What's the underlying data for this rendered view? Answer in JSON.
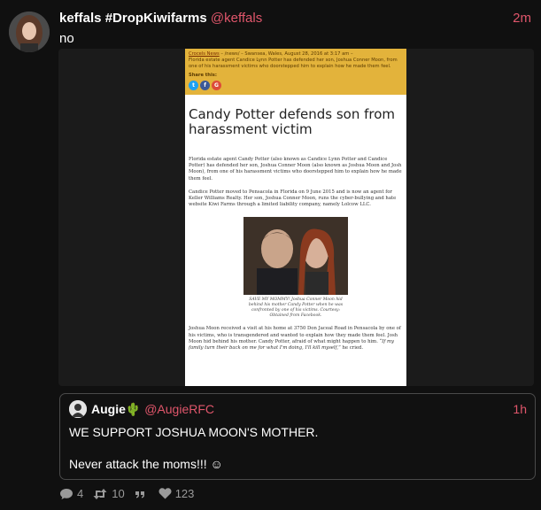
{
  "post": {
    "display_name": "keffals #DropKiwifarms",
    "handle": "@keffals",
    "time": "2m",
    "text": "no"
  },
  "article": {
    "header_line1_link": "Crocels News",
    "header_line1_rest": " – /news/ – Swansea, Wales, August 28, 2016 at 3:17 am –",
    "header_line2": "Florida estate agent Candice Lynn Potter has defended her son, Joshua Conner Moon, from one of his harassment victims who doorstepped him to explain how he made them feel.",
    "share_label": "Share this:",
    "share_icons": [
      "twitter-icon",
      "facebook-icon",
      "google-plus-icon"
    ],
    "title": "Candy Potter defends son from harassment victim",
    "para1": "Florida estate agent Candy Potter (also known as Candice Lynn Potter and Candice Potter) has defended her son, Joshua Conner Moon (also known as Joshua Moon and Josh Moon), from one of his harassment victims who doorstepped him to explain how he made them feel.",
    "para2": "Candice Potter moved to Pensacola in Florida on 9 June 2015 and is now an agent for Keller Williams Realty. Her son, Joshua Conner Moon, runs the cyber-bullying and hate website Kiwi Farms through a limited liability company, namely Lolcow LLC.",
    "caption": "SAVE MY MOMMY! Joshua Conner Moon hid behind his mother Candy Potter when he was confronted by one of his victims. Courtesy: Obtained from Facebook.",
    "para3_a": "Joshua Moon received a visit at his home at 3750 Don Jaceal Road in Pensacola by one of his victims, who is transgendered and wanted to explain how they made them feel. Josh Moon hid behind his mother. Candy Potter, afraid of what might happen to him. ",
    "para3_quote": "“If my family turn their back on me for what I'm doing, I'll kill myself,”",
    "para3_b": " he cried."
  },
  "quote": {
    "display_name": "Augie",
    "emoji": "🌵",
    "handle": "@AugieRFC",
    "time": "1h",
    "line1": "WE SUPPORT JOSHUA MOON'S MOTHER.",
    "line2": "Never attack the moms!!! ☺"
  },
  "actions": {
    "replies": "4",
    "reposts": "10",
    "quotes": "",
    "likes": "123"
  },
  "colors": {
    "accent": "#e0566b",
    "background": "#101010",
    "header_bar": "#e3b33b"
  }
}
